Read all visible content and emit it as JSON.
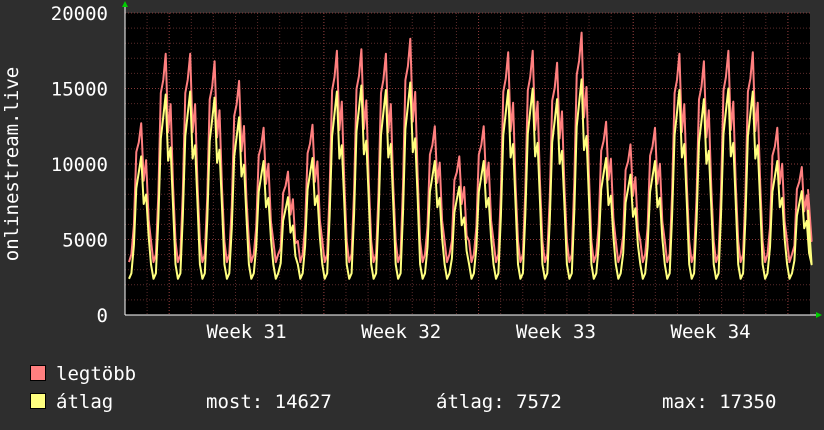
{
  "chart_data": {
    "type": "line",
    "ylabel": "onlinestream.live",
    "yticks": [
      0,
      5000,
      10000,
      15000,
      20000
    ],
    "ylim": [
      0,
      20000
    ],
    "x_tick_labels": [
      "Week 31",
      "Week 32",
      "Week 33",
      "Week 34"
    ],
    "grid": true,
    "legend_placement": "bottom-left",
    "series": [
      {
        "name": "legtöbb",
        "color": "#ff7f7f",
        "pattern": {
          "days": 29,
          "day_peaks": [
            12700,
            17300,
            17300,
            16800,
            15500,
            12400,
            9500,
            12600,
            17500,
            17600,
            17300,
            18300,
            12500,
            10500,
            12500,
            17400,
            17500,
            16700,
            18700,
            12800,
            11300,
            12400,
            17300,
            16800,
            17500,
            17400,
            12400,
            9800
          ],
          "day_min": 3500,
          "day_sub_peak_ratio": 0.85
        }
      },
      {
        "name": "átlag",
        "color": "#ffff7f",
        "pattern": {
          "days": 29,
          "day_peaks": [
            10500,
            14600,
            14800,
            14400,
            13100,
            10200,
            7800,
            10400,
            14800,
            15200,
            14900,
            15400,
            10200,
            8500,
            10200,
            14900,
            15000,
            14300,
            15600,
            10400,
            9300,
            10200,
            14900,
            14300,
            15000,
            14800,
            10200,
            8200
          ],
          "day_min": 2400,
          "day_sub_peak_ratio": 0.8
        }
      }
    ]
  },
  "legend": {
    "items": [
      {
        "label": "legtöbb",
        "color": "#ff7f7f"
      },
      {
        "label": "átlag",
        "color": "#ffff7f"
      }
    ]
  },
  "stats": {
    "most": "most: 14627",
    "atlag": "átlag: 7572",
    "max": "max: 17350"
  }
}
